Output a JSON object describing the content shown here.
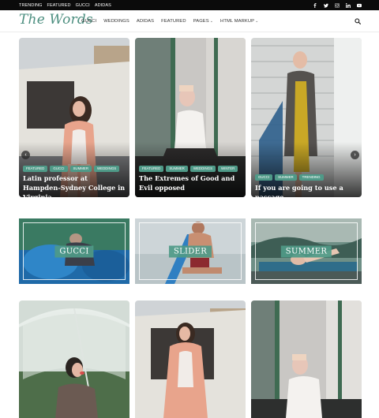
{
  "top_bar": {
    "links": [
      "TRENDING",
      "FEATURED",
      "GUCCI",
      "ADIDAS"
    ],
    "social_icons": [
      "facebook-icon",
      "twitter-icon",
      "instagram-icon",
      "linkedin-icon",
      "youtube-icon"
    ]
  },
  "header": {
    "logo": "The Words",
    "nav": [
      {
        "label": "GUCCI",
        "has_dropdown": false
      },
      {
        "label": "WEDDINGS",
        "has_dropdown": false
      },
      {
        "label": "ADIDAS",
        "has_dropdown": false
      },
      {
        "label": "FEATURED",
        "has_dropdown": false
      },
      {
        "label": "PAGES",
        "has_dropdown": true
      },
      {
        "label": "HTML MARKUP",
        "has_dropdown": true
      }
    ],
    "search_icon": "search-icon"
  },
  "slider": {
    "prev_icon": "chevron-left-icon",
    "next_icon": "chevron-right-icon",
    "slides": [
      {
        "tags": [
          "FEATURED",
          "GUCCI",
          "SUMMER",
          "WEDDINGS"
        ],
        "title": "Latin professor at Hampden-Sydney College in Virginia"
      },
      {
        "tags": [
          "FEATURED",
          "SUMMER",
          "WEDDINGS",
          "WINTER"
        ],
        "title": "The Extremes of Good and Evil opposed"
      },
      {
        "tags": [
          "GUCCI",
          "SUMMER",
          "TRENDING"
        ],
        "title": "If you are going to use a passage"
      }
    ]
  },
  "categories": [
    {
      "label": "GUCCI"
    },
    {
      "label": "SLIDER"
    },
    {
      "label": "SUMMER"
    }
  ],
  "colors": {
    "accent": "#4f9a88",
    "logo": "#4d8f80",
    "topbar": "#0b0b0b"
  }
}
